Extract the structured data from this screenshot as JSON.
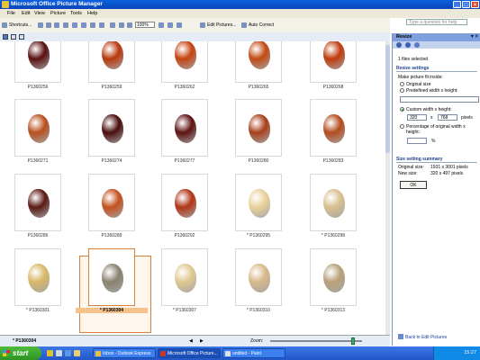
{
  "window": {
    "title": "Microsoft Office Picture Manager"
  },
  "menu": {
    "items": [
      "File",
      "Edit",
      "View",
      "Picture",
      "Tools",
      "Help"
    ],
    "help_placeholder": "Type a question for help"
  },
  "toolbar": {
    "shortcuts_label": "Shortcuts...",
    "zoom_value": "100%",
    "edit_pictures_label": "Edit Pictures...",
    "auto_correct_label": "Auto Correct"
  },
  "gallery": {
    "rows": [
      [
        {
          "name": "P1360256",
          "color": "#5a1010"
        },
        {
          "name": "P1360259",
          "color": "#b8380c"
        },
        {
          "name": "P1360262",
          "color": "#c4440e"
        },
        {
          "name": "P1360265",
          "color": "#c24a12"
        },
        {
          "name": "P1360268",
          "color": "#c03a0c"
        }
      ],
      [
        {
          "name": "P1360271",
          "color": "#b6501c"
        },
        {
          "name": "P1360274",
          "color": "#4a0c0c"
        },
        {
          "name": "P1360277",
          "color": "#5c1210"
        },
        {
          "name": "P1360280",
          "color": "#a8401a"
        },
        {
          "name": "P1360283",
          "color": "#b44c1c"
        }
      ],
      [
        {
          "name": "P1360286",
          "color": "#5a1a14"
        },
        {
          "name": "P1360289",
          "color": "#c4501e"
        },
        {
          "name": "P1360292",
          "color": "#b03616"
        },
        {
          "name": "* P1360295",
          "color": "#e8d09a"
        },
        {
          "name": "* P1360298",
          "color": "#d8c090"
        }
      ],
      [
        {
          "name": "* P1360301",
          "color": "#d8b868"
        },
        {
          "name": "* P1360304",
          "color": "#8a8270",
          "selected": true
        },
        {
          "name": "* P1360307",
          "color": "#e0c890"
        },
        {
          "name": "* P1360310",
          "color": "#d8b88a"
        },
        {
          "name": "* P1360313",
          "color": "#b8a07a"
        }
      ]
    ]
  },
  "statusbar": {
    "current": "* P1360304",
    "zoom_label": "Zoom:"
  },
  "resize_pane": {
    "title": "Resize",
    "selected_count": "1 files selected",
    "settings_heading": "Resize settings",
    "make_fit_label": "Make picture fit inside:",
    "original_size": "Original size",
    "predefined_label": "Predefined width x height:",
    "custom_label": "Custom width x height:",
    "custom_width": "320",
    "x_label": "x",
    "custom_height": "768",
    "pixels_label": "pixels",
    "percentage_label": "Percentage of original width x height:",
    "percent_value": "",
    "percent_sign": "%",
    "summary_heading": "Size setting summary",
    "original_size_label": "Original size:",
    "original_size_value": "1931 x 3001 pixels",
    "new_size_label": "New size:",
    "new_size_value": "320 x 497 pixels",
    "ok_label": "OK",
    "back_link": "Back to Edit Pictures"
  },
  "taskbar": {
    "start_label": "start",
    "tasks": [
      {
        "label": "Inbox - Outlook Express",
        "color": "#e8c040"
      },
      {
        "label": "Microsoft Office Picture...",
        "color": "#c43a2a",
        "active": true
      },
      {
        "label": "untitled - Paint",
        "color": "#e0e0e0"
      }
    ],
    "clock": "15:27"
  }
}
